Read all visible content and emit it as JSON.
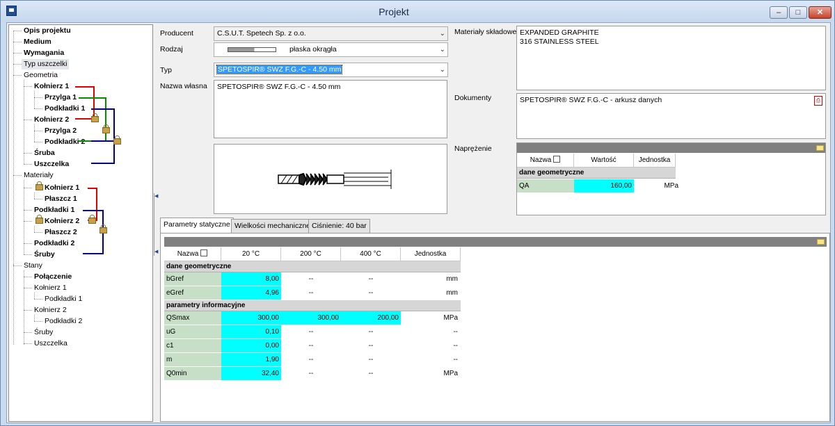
{
  "window": {
    "title": "Projekt",
    "minimize": "–",
    "maximize": "□",
    "close": "✕"
  },
  "tree": {
    "opis": "Opis projektu",
    "medium": "Medium",
    "wymagania": "Wymagania",
    "typ": "Typ uszczelki",
    "geometria": "Geometria",
    "g_kolnierz1": "Kołnierz 1",
    "g_przylga1": "Przylga 1",
    "g_podkladki1": "Podkładki 1",
    "g_kolnierz2": "Kołnierz 2",
    "g_przylga2": "Przylga 2",
    "g_podkladki2": "Podkładki 2",
    "g_sruba": "Śruba",
    "g_uszczelka": "Uszczelka",
    "materialy": "Materiały",
    "m_kolnierz1": "Kołnierz 1",
    "m_plaszcz1": "Płaszcz 1",
    "m_podkladki1": "Podkładki 1",
    "m_kolnierz2": "Kołnierz 2",
    "m_plaszcz2": "Płaszcz 2",
    "m_podkladki2": "Podkładki 2",
    "m_sruby": "Śruby",
    "stany": "Stany",
    "s_polaczenie": "Połączenie",
    "s_kolnierz1": "Kołnierz 1",
    "s_podkladki1": "Podkładki 1",
    "s_kolnierz2": "Kołnierz 2",
    "s_podkladki2": "Podkładki 2",
    "s_sruby": "Śruby",
    "s_uszczelka": "Uszczelka"
  },
  "form": {
    "producent_label": "Producent",
    "producent_value": "C.S.U.T. Spetech Sp. z o.o.",
    "rodzaj_label": "Rodzaj",
    "rodzaj_value": "płaska okrągła",
    "typ_label": "Typ",
    "typ_value": "SPETOSPIR® SWZ F.G.-C  - 4.50  mm",
    "nazwa_label": "Nazwa własna",
    "nazwa_value": "SPETOSPIR® SWZ F.G.-C  - 4.50  mm",
    "materialy_label": "Materiały składowe",
    "materialy_line1": "EXPANDED GRAPHITE",
    "materialy_line2": "316 STAINLESS STEEL",
    "dokumenty_label": "Dokumenty",
    "dokumenty_value": "SPETOSPIR® SWZ F.G.-C - arkusz danych",
    "naprezenie_label": "Naprężenie"
  },
  "stress_table": {
    "headers": [
      "Nazwa",
      "Wartość",
      "Jednostka"
    ],
    "group": "dane geometryczne",
    "row": {
      "name": "QA",
      "value": "160,00",
      "unit": "MPa"
    }
  },
  "tabs": [
    "Parametry statyczne",
    "Wielkości mechaniczne",
    "Ciśnienie: 40 bar"
  ],
  "params_table": {
    "headers": [
      "Nazwa",
      "20 °C",
      "200 °C",
      "400 °C",
      "Jednostka"
    ],
    "group1": "dane geometryczne",
    "group2": "parametry informacyjne",
    "rows": [
      {
        "name": "bGref",
        "v20": "8,00",
        "v200": "--",
        "v400": "--",
        "unit": "mm"
      },
      {
        "name": "eGref",
        "v20": "4,96",
        "v200": "--",
        "v400": "--",
        "unit": "mm"
      },
      {
        "name": "QSmax",
        "v20": "300,00",
        "v200": "300,00",
        "v400": "200,00",
        "unit": "MPa"
      },
      {
        "name": "uG",
        "v20": "0,10",
        "v200": "--",
        "v400": "--",
        "unit": "--"
      },
      {
        "name": "c1",
        "v20": "0,00",
        "v200": "--",
        "v400": "--",
        "unit": "--"
      },
      {
        "name": "m",
        "v20": "1,90",
        "v200": "--",
        "v400": "--",
        "unit": "--"
      },
      {
        "name": "Q0min",
        "v20": "32,40",
        "v200": "--",
        "v400": "--",
        "unit": "MPa"
      }
    ]
  },
  "colors": {
    "value_cell": "#00ffff",
    "name_cell": "#c6dfc6",
    "group_row": "#d6d6d6",
    "link_red": "#e00000",
    "link_green": "#009000",
    "link_blue": "#000080"
  }
}
